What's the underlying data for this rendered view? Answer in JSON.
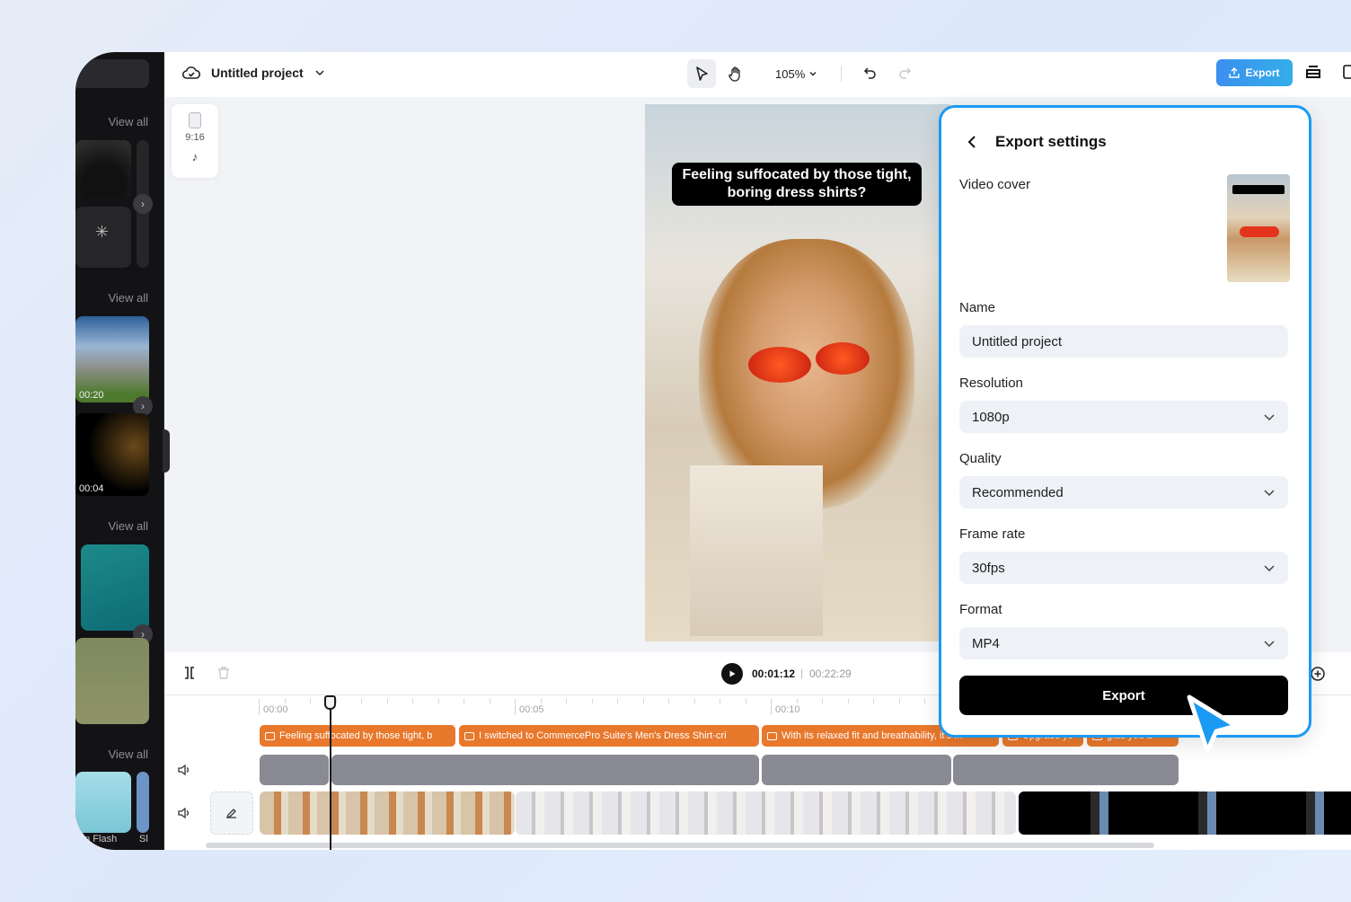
{
  "sidebar": {
    "sections": [
      {
        "view_all": "View all"
      },
      {
        "view_all": "View all",
        "items": [
          {
            "duration": "00:20"
          },
          {
            "duration": "00:04"
          }
        ]
      },
      {
        "view_all": "View all"
      },
      {
        "view_all": "View all",
        "items": [
          {
            "label": "on Flash"
          },
          {
            "label": "Sl"
          }
        ]
      }
    ]
  },
  "header": {
    "project_title": "Untitled project",
    "zoom": "105%",
    "export_label": "Export"
  },
  "canvas": {
    "aspect_ratio": "9:16",
    "caption": "Feeling suffocated by those tight, boring dress shirts?"
  },
  "timeline": {
    "current_time": "00:01:12",
    "separator": "|",
    "total_time": "00:22:29",
    "ruler": [
      "00:00",
      "00:05",
      "00:10"
    ],
    "captions": [
      "Feeling suffocated by those tight, b",
      "I switched to CommercePro Suite's Men's Dress Shirt-cri",
      "With its relaxed fit and breathability, it's m",
      "Upgrade yo",
      "glad you a"
    ]
  },
  "export_panel": {
    "title": "Export settings",
    "video_cover_label": "Video cover",
    "name_label": "Name",
    "name_value": "Untitled project",
    "resolution_label": "Resolution",
    "resolution_value": "1080p",
    "quality_label": "Quality",
    "quality_value": "Recommended",
    "frame_rate_label": "Frame rate",
    "frame_rate_value": "30fps",
    "format_label": "Format",
    "format_value": "MP4",
    "export_button": "Export"
  },
  "colors": {
    "accent": "#1a9af3",
    "caption_clip": "#e8782c",
    "audio_clip": "#8a8a94"
  }
}
